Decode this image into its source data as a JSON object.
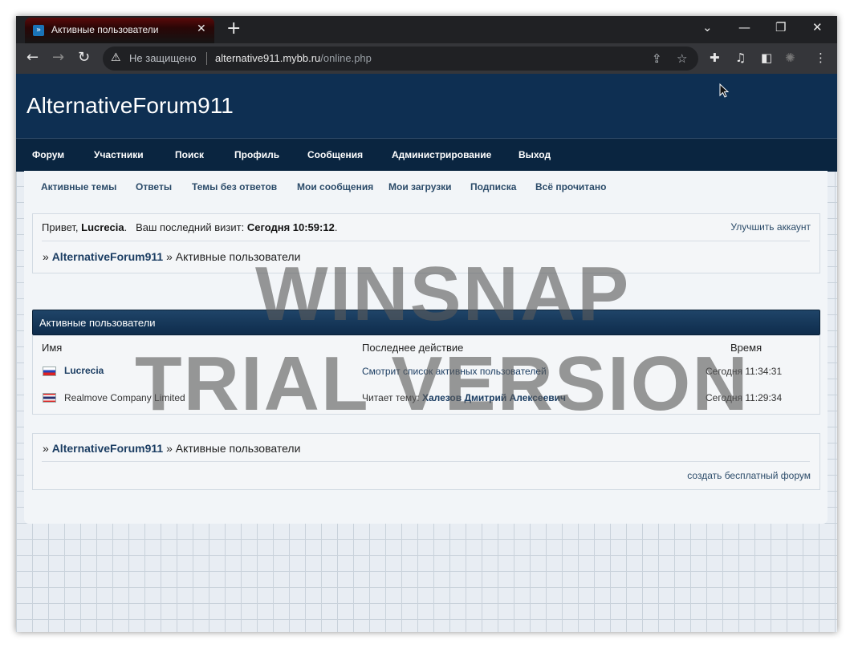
{
  "browser": {
    "tab_title": "Активные пользователи",
    "tab_favicon": "»",
    "new_tab": "+",
    "security_label": "Не защищено",
    "url_host": "alternative911.mybb.ru",
    "url_path": "/online.php"
  },
  "site": {
    "title": "AlternativeForum911"
  },
  "main_nav": [
    "Форум",
    "Участники",
    "Поиск",
    "Профиль",
    "Сообщения",
    "Администрирование",
    "Выход"
  ],
  "sub_nav": [
    "Активные темы",
    "Ответы",
    "Темы без ответов",
    "Мои сообщения",
    "Мои загрузки",
    "Подписка",
    "Всё прочитано"
  ],
  "welcome": {
    "greeting": "Привет,",
    "user": "Lucrecia",
    "last_visit_label": "Ваш последний визит:",
    "last_visit_value": "Сегодня 10:59:12",
    "upgrade": "Улучшить аккаунт"
  },
  "breadcrumb": {
    "sep": "»",
    "home": "AlternativeForum911",
    "current": "Активные пользователи"
  },
  "online_table": {
    "heading": "Активные пользователи",
    "columns": [
      "Имя",
      "Последнее действие",
      "Время"
    ],
    "rows": [
      {
        "flag": "ru",
        "name": "Lucrecia",
        "action": "Смотрит список активных пользователей",
        "action_topic": "",
        "time": "Сегодня 11:34:31"
      },
      {
        "flag": "th",
        "name": "Realmove Company Limited",
        "action": "Читает тему:",
        "action_topic": "Халезов Дмитрий Алексеевич",
        "time": "Сегодня 11:29:34"
      }
    ]
  },
  "footer": {
    "create_forum": "создать бесплатный форум"
  },
  "watermark": {
    "line1": "WINSNAP",
    "line2": "TRIAL VERSION"
  },
  "colors": {
    "banner": "#0e2f52",
    "nav": "#0a2540",
    "link": "#1c3e63"
  }
}
